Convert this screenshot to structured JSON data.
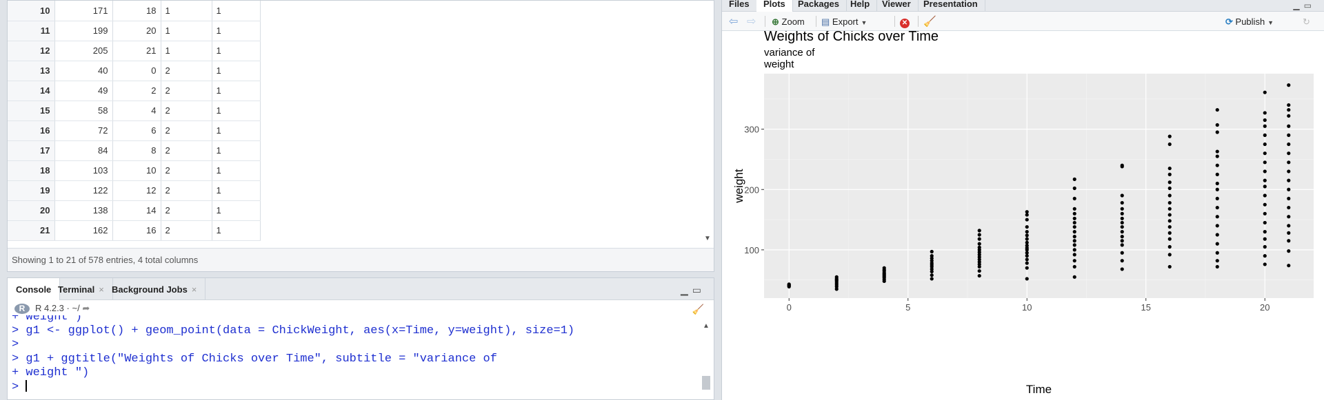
{
  "data_viewer": {
    "rows": [
      {
        "n": "10",
        "weight": "171",
        "time": "18",
        "chick": "1",
        "diet": "1"
      },
      {
        "n": "11",
        "weight": "199",
        "time": "20",
        "chick": "1",
        "diet": "1"
      },
      {
        "n": "12",
        "weight": "205",
        "time": "21",
        "chick": "1",
        "diet": "1"
      },
      {
        "n": "13",
        "weight": "40",
        "time": "0",
        "chick": "2",
        "diet": "1"
      },
      {
        "n": "14",
        "weight": "49",
        "time": "2",
        "chick": "2",
        "diet": "1"
      },
      {
        "n": "15",
        "weight": "58",
        "time": "4",
        "chick": "2",
        "diet": "1"
      },
      {
        "n": "16",
        "weight": "72",
        "time": "6",
        "chick": "2",
        "diet": "1"
      },
      {
        "n": "17",
        "weight": "84",
        "time": "8",
        "chick": "2",
        "diet": "1"
      },
      {
        "n": "18",
        "weight": "103",
        "time": "10",
        "chick": "2",
        "diet": "1"
      },
      {
        "n": "19",
        "weight": "122",
        "time": "12",
        "chick": "2",
        "diet": "1"
      },
      {
        "n": "20",
        "weight": "138",
        "time": "14",
        "chick": "2",
        "diet": "1"
      },
      {
        "n": "21",
        "weight": "162",
        "time": "16",
        "chick": "2",
        "diet": "1"
      }
    ],
    "status": "Showing 1 to 21 of 578 entries, 4 total columns"
  },
  "console": {
    "tabs": [
      {
        "label": "Console",
        "closable": false
      },
      {
        "label": "Terminal",
        "closable": true
      },
      {
        "label": "Background Jobs",
        "closable": true
      }
    ],
    "r_version": "R 4.2.3",
    "path": "· ~/",
    "lines": [
      "+ weight\")",
      "> g1 <- ggplot() + geom_point(data = ChickWeight, aes(x=Time, y=weight), size=1)",
      ">",
      "> g1 + ggtitle(\"Weights of Chicks over Time\", subtitle = \"variance of",
      "+ weight \")",
      "> "
    ]
  },
  "right_pane": {
    "tabs": [
      "Files",
      "Plots",
      "Packages",
      "Help",
      "Viewer",
      "Presentation"
    ],
    "active_tab": "Plots",
    "toolbar": {
      "zoom": "Zoom",
      "export": "Export",
      "publish": "Publish"
    }
  },
  "icons": {
    "back": "back-arrow-icon",
    "forward": "forward-arrow-icon",
    "zoom": "zoom-icon",
    "export": "export-icon",
    "delete": "delete-icon",
    "clear": "broom-icon",
    "publish": "publish-icon",
    "refresh": "refresh-icon"
  },
  "chart_data": {
    "type": "scatter",
    "title": "Weights of Chicks over Time",
    "subtitle": [
      "variance of",
      "weight"
    ],
    "xlabel": "Time",
    "ylabel": "weight",
    "xlim": [
      -1.05,
      22.05
    ],
    "ylim": [
      20,
      392
    ],
    "xticks": [
      0,
      5,
      10,
      15,
      20
    ],
    "yticks": [
      100,
      200,
      300
    ],
    "grid": true,
    "panel_color": "#ebebeb",
    "point_color": "#000000",
    "points": [
      {
        "x": 0,
        "y": [
          39,
          40,
          41,
          42,
          43
        ]
      },
      {
        "x": 2,
        "y": [
          35,
          39,
          42,
          45,
          48,
          50,
          52,
          55
        ]
      },
      {
        "x": 4,
        "y": [
          48,
          51,
          54,
          56,
          58,
          60,
          62,
          65,
          67,
          70
        ]
      },
      {
        "x": 6,
        "y": [
          52,
          58,
          64,
          68,
          72,
          75,
          78,
          82,
          86,
          90,
          97
        ]
      },
      {
        "x": 8,
        "y": [
          57,
          65,
          72,
          76,
          80,
          84,
          88,
          92,
          96,
          100,
          104,
          110,
          118,
          125,
          132
        ]
      },
      {
        "x": 10,
        "y": [
          52,
          70,
          78,
          84,
          90,
          95,
          100,
          103,
          107,
          112,
          118,
          124,
          130,
          138,
          150,
          158,
          163
        ]
      },
      {
        "x": 12,
        "y": [
          55,
          72,
          82,
          92,
          100,
          108,
          115,
          122,
          130,
          138,
          145,
          152,
          160,
          168,
          185,
          202,
          217
        ]
      },
      {
        "x": 14,
        "y": [
          68,
          82,
          95,
          108,
          115,
          122,
          130,
          138,
          145,
          152,
          160,
          168,
          178,
          190,
          238,
          240
        ]
      },
      {
        "x": 16,
        "y": [
          72,
          92,
          105,
          118,
          128,
          138,
          148,
          158,
          168,
          178,
          190,
          202,
          212,
          225,
          235,
          275,
          288
        ]
      },
      {
        "x": 18,
        "y": [
          72,
          82,
          95,
          110,
          125,
          140,
          155,
          170,
          185,
          200,
          210,
          225,
          240,
          255,
          263,
          295,
          307,
          332
        ]
      },
      {
        "x": 20,
        "y": [
          76,
          90,
          105,
          118,
          130,
          145,
          160,
          175,
          190,
          205,
          215,
          230,
          245,
          260,
          275,
          290,
          305,
          315,
          327,
          361
        ]
      },
      {
        "x": 21,
        "y": [
          74,
          98,
          115,
          128,
          140,
          155,
          170,
          185,
          200,
          215,
          230,
          245,
          260,
          275,
          290,
          305,
          322,
          332,
          340,
          373
        ]
      }
    ]
  }
}
